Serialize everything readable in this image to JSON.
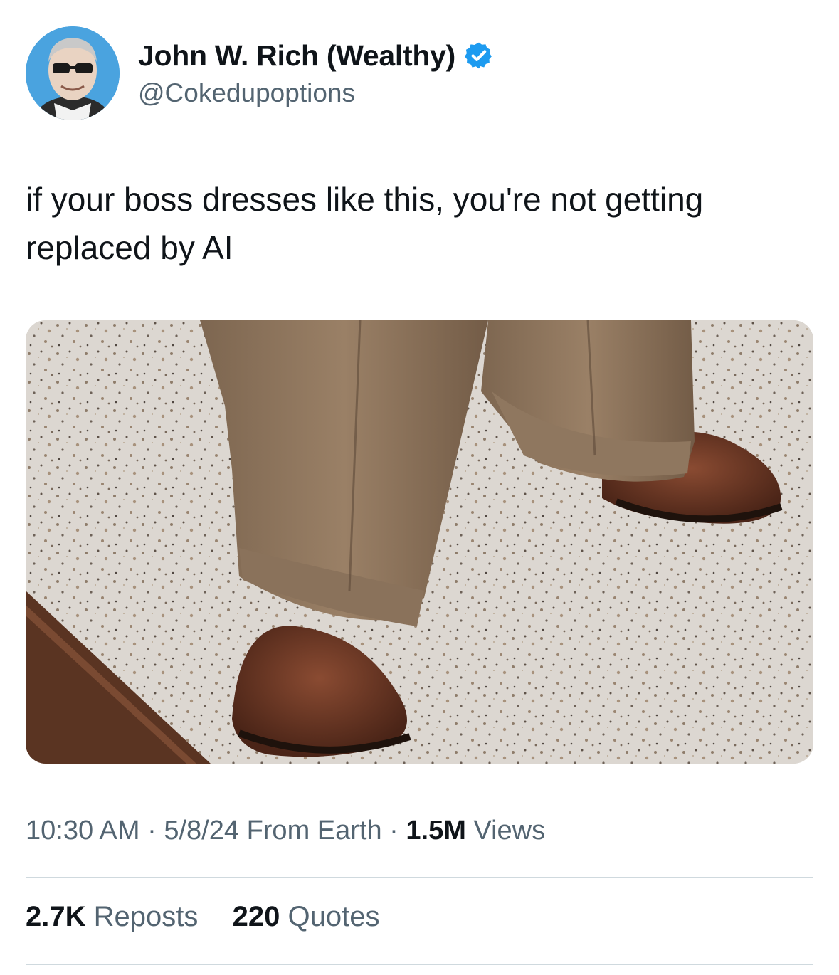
{
  "author": {
    "display_name": "John W. Rich (Wealthy)",
    "handle": "@Cokedupoptions",
    "verified": true,
    "verified_color": "#1d9bf0",
    "avatar_icon": "cartoon-old-man-avatar"
  },
  "tweet": {
    "line1": "if your boss dresses like this, you're not getting",
    "line2": "replaced by AI",
    "media_icon": "photo-brown-pants-and-shoes"
  },
  "meta": {
    "time": "10:30 AM",
    "sep1": "·",
    "date": "5/8/24",
    "source": "From Earth",
    "sep2": "·",
    "views_count": "1.5M",
    "views_label": "Views"
  },
  "stats": {
    "reposts_count": "2.7K",
    "reposts_label": "Reposts",
    "quotes_count": "220",
    "quotes_label": "Quotes"
  }
}
